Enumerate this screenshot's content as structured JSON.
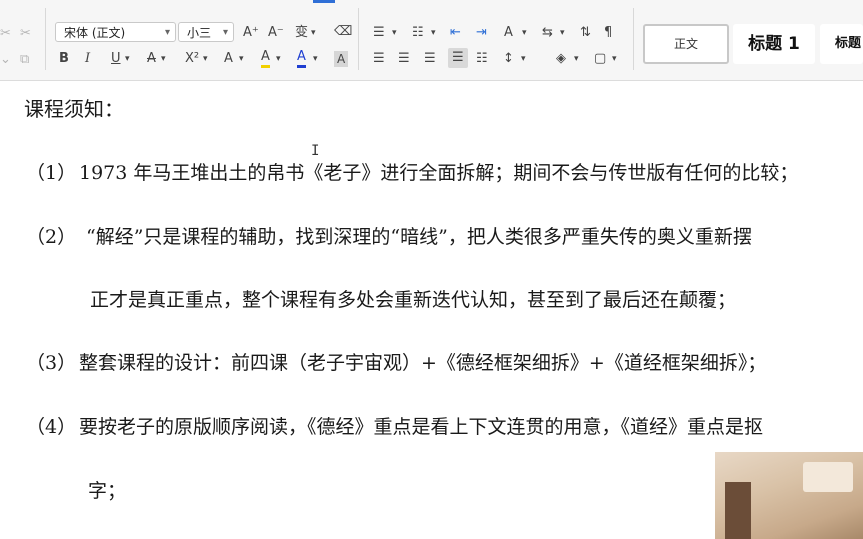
{
  "toolbar": {
    "font_name": "宋体 (正文)",
    "font_size": "小三",
    "grow_font": "A⁺",
    "shrink_font": "A⁻",
    "phonetic": "变",
    "bold": "B",
    "italic": "I",
    "underline": "U",
    "strike": "A",
    "superscript": "X²",
    "effects": "A",
    "highlight": "A",
    "font_color": "A",
    "char_shade": "A"
  },
  "styles": {
    "normal": "正文",
    "heading1": "标题 1",
    "heading2": "标题"
  },
  "document": {
    "title": "课程须知：",
    "items": [
      {
        "num": "（1）",
        "text": "1973 年马王堆出土的帛书《老子》进行全面拆解；期间不会与传世版有任何的比较；"
      },
      {
        "num": "（2）",
        "text": "“解经”只是课程的辅助，找到深理的“暗线”，把人类很多严重失传的奥义重新摆"
      },
      {
        "num": "",
        "text": "正才是真正重点，整个课程有多处会重新迭代认知，甚至到了最后还在颠覆；"
      },
      {
        "num": "（3）",
        "text": "整套课程的设计：前四课（老子宇宙观）+《德经框架细拆》+《道经框架细拆》；"
      },
      {
        "num": "（4）",
        "text": "要按老子的原版顺序阅读，《德经》重点是看上下文连贯的用意，《道经》重点是抠"
      },
      {
        "num": "",
        "text": "字；"
      }
    ]
  },
  "colors": {
    "highlight_yellow": "#f2d100",
    "font_color_blue": "#1f3fd1",
    "accent_blue": "#2f6fd6"
  }
}
